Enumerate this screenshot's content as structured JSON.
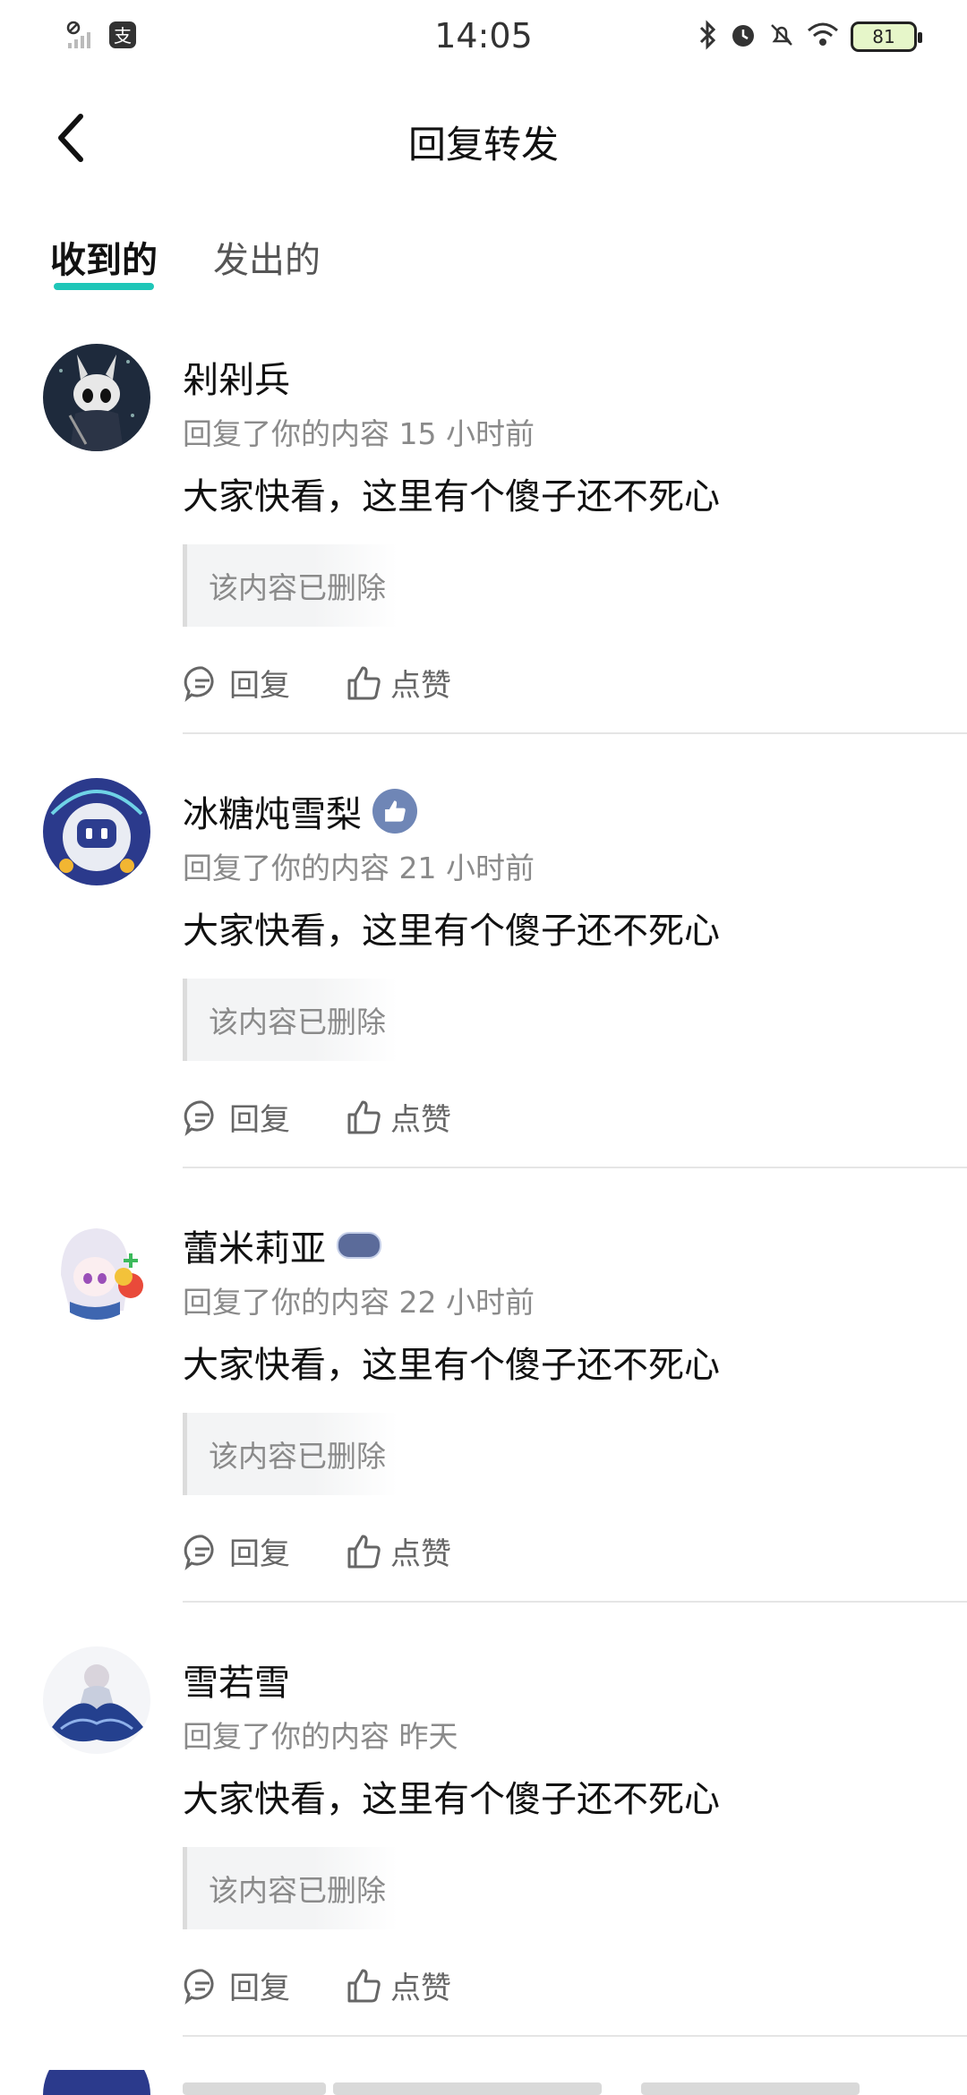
{
  "status_bar": {
    "time": "14:05",
    "battery": "81",
    "icons": [
      "signal-icon",
      "pay-app-icon",
      "bluetooth-icon",
      "alarm-icon",
      "mute-icon",
      "wifi-icon",
      "battery-icon"
    ]
  },
  "header": {
    "title": "回复转发",
    "back_icon": "chevron-left-icon"
  },
  "tabs": [
    {
      "label": "收到的",
      "active": true
    },
    {
      "label": "发出的",
      "active": false
    }
  ],
  "actions": {
    "reply_label": "回复",
    "like_label": "点赞"
  },
  "items": [
    {
      "name": "剁剁兵",
      "badge": "",
      "meta": "回复了你的内容 15 小时前",
      "text": "大家快看，这里有个傻子还不死心",
      "quote": "该内容已删除"
    },
    {
      "name": "冰糖炖雪梨",
      "badge": "like-badge-icon",
      "meta": "回复了你的内容 21 小时前",
      "text": "大家快看，这里有个傻子还不死心",
      "quote": "该内容已删除"
    },
    {
      "name": "蕾米莉亚",
      "badge": "level-badge-icon",
      "meta": "回复了你的内容 22 小时前",
      "text": "大家快看，这里有个傻子还不死心",
      "quote": "该内容已删除"
    },
    {
      "name": "雪若雪",
      "badge": "",
      "meta": "回复了你的内容 昨天",
      "text": "大家快看，这里有个傻子还不死心",
      "quote": "该内容已删除"
    }
  ],
  "colors": {
    "accent": "#1fc6b8",
    "meta_text": "#8a8a8a"
  }
}
